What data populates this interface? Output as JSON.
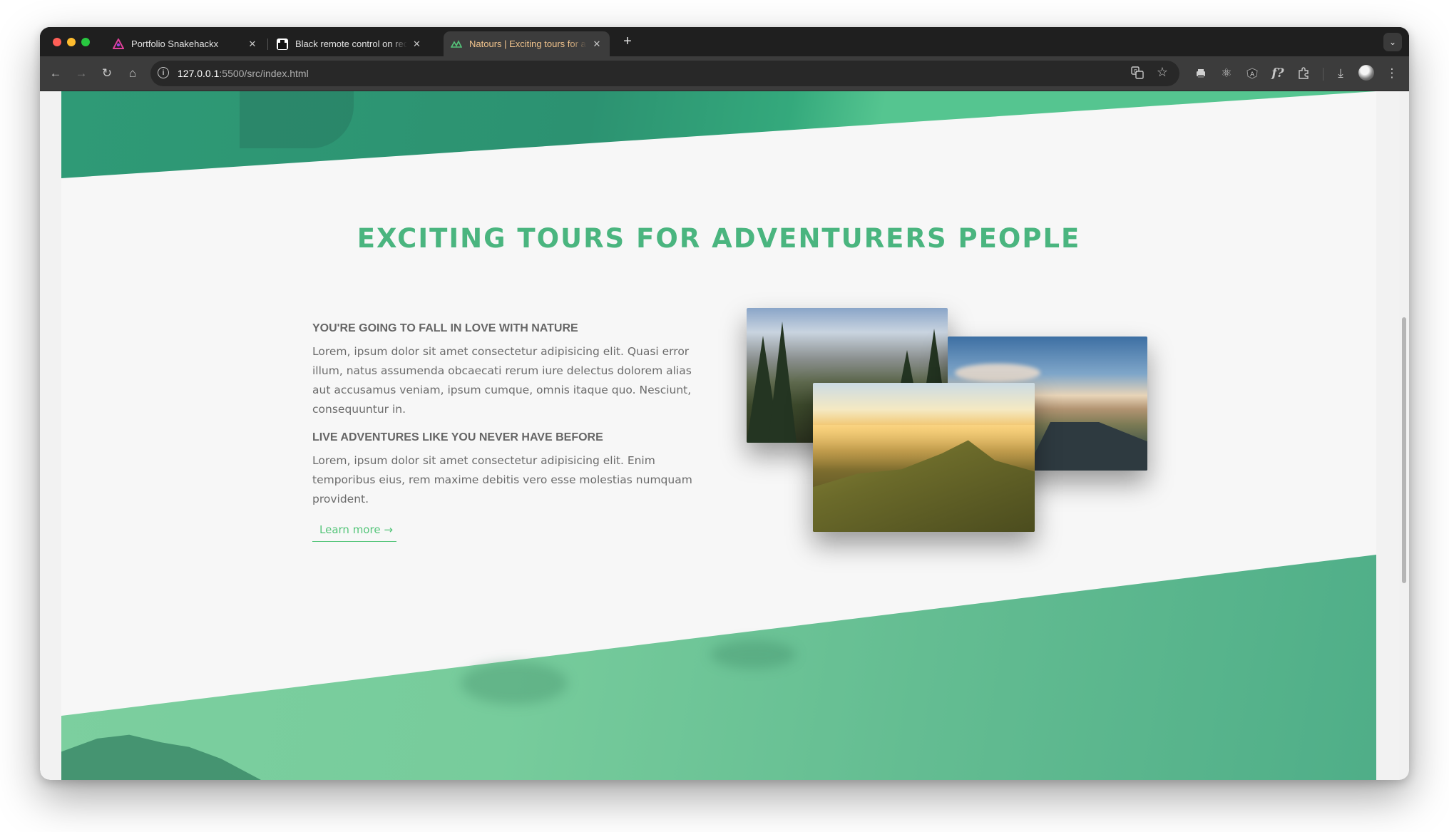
{
  "browser": {
    "tabs": [
      {
        "title": "Portfolio Snakehackx",
        "favicon": "pink-logo-icon",
        "active": false
      },
      {
        "title": "Black remote control on red t",
        "favicon": "image-icon",
        "active": false
      },
      {
        "title": "Natours | Exciting tours for a",
        "favicon": "natours-logo-icon",
        "active": true
      }
    ],
    "new_tab_label": "+",
    "url_host": "127.0.0.1",
    "url_path": ":5500/src/index.html"
  },
  "page": {
    "heading": "EXCITING TOURS FOR ADVENTURERS PEOPLE",
    "features": [
      {
        "title": "YOU'RE GOING TO FALL IN LOVE WITH NATURE",
        "text": "Lorem, ipsum dolor sit amet consectetur adipisicing elit. Quasi error illum, natus assumenda obcaecati rerum iure delectus dolorem alias aut accusamus veniam, ipsum cumque, omnis itaque quo. Nesciunt, consequuntur in."
      },
      {
        "title": "LIVE ADVENTURES LIKE YOU NEVER HAVE BEFORE",
        "text": "Lorem, ipsum dolor sit amet consectetur adipisicing elit. Enim temporibus eius, rem maxime debitis vero esse molestias numquam provident."
      }
    ],
    "learn_more": "Learn more →",
    "colors": {
      "primary_green": "#55c57a",
      "heading_green": "#4ab57f",
      "text_grey": "#6b6b6b"
    }
  }
}
